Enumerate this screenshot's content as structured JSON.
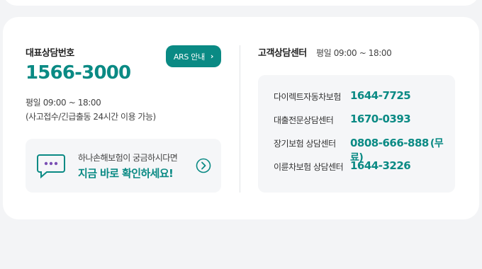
{
  "representative": {
    "title": "대표상담번호",
    "ars_label": "ARS 안내",
    "phone": "1566-3000",
    "hours": "평일  09:00 ~ 18:00",
    "hours_note": "(사고접수/긴급출동 24시간 이용 가능)"
  },
  "promo": {
    "line1": "하나손해보험이 궁금하시다면",
    "line2": "지금 바로 확인하세요!",
    "icon": "chat-bubble-icon"
  },
  "customer_center": {
    "title": "고객상담센터",
    "hours": "평일  09:00 ~ 18:00",
    "centers": [
      {
        "name": "다이렉트자동차보험",
        "phone": "1644-7725",
        "note": ""
      },
      {
        "name": "대출전문상담센터",
        "phone": "1670-0393",
        "note": ""
      },
      {
        "name": "장기보험 상담센터",
        "phone": "0808-666-888",
        "note": "(무료)"
      },
      {
        "name": "이륜차보험 상담센터",
        "phone": "1644-3226",
        "note": ""
      }
    ]
  },
  "colors": {
    "accent": "#0a8a84",
    "chat_icon": "#7a4fb4",
    "panel_bg": "#f5f6f8"
  }
}
